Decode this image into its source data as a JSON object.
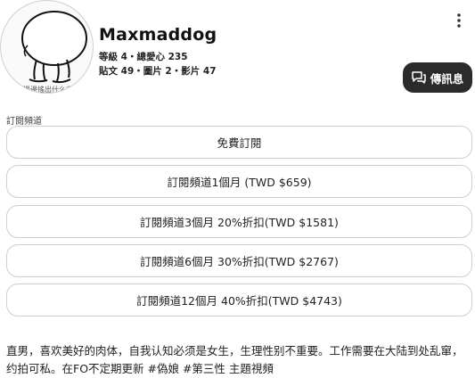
{
  "profile": {
    "name": "Maxmaddog",
    "avatar_caption": "邊邊搖出什么言",
    "stats_row1": "等級 4・總愛心 235",
    "stats_row2": "貼文 49・圖片 2・影片 47"
  },
  "actions": {
    "message_label": "傳訊息",
    "more_icon": "more-vertical-icon",
    "message_icon": "chat-icon"
  },
  "subscriptions": {
    "section_label": "訂閱頻道",
    "options": [
      {
        "label": "免費訂閱"
      },
      {
        "label": "訂閱頻道1個月 (TWD $659)"
      },
      {
        "label": "訂閱頻道3個月 20%折扣(TWD $1581)"
      },
      {
        "label": "訂閱頻道6個月 30%折扣(TWD $2767)"
      },
      {
        "label": "訂閱頻道12個月 40%折扣(TWD $4743)"
      }
    ]
  },
  "bio": "直男，喜欢美好的肉体，自我认知必须是女生，生理性别不重要。工作需要在大陆到处乱窜，约拍可私。在FO不定期更新 #偽娘 #第三性 主題視頻"
}
